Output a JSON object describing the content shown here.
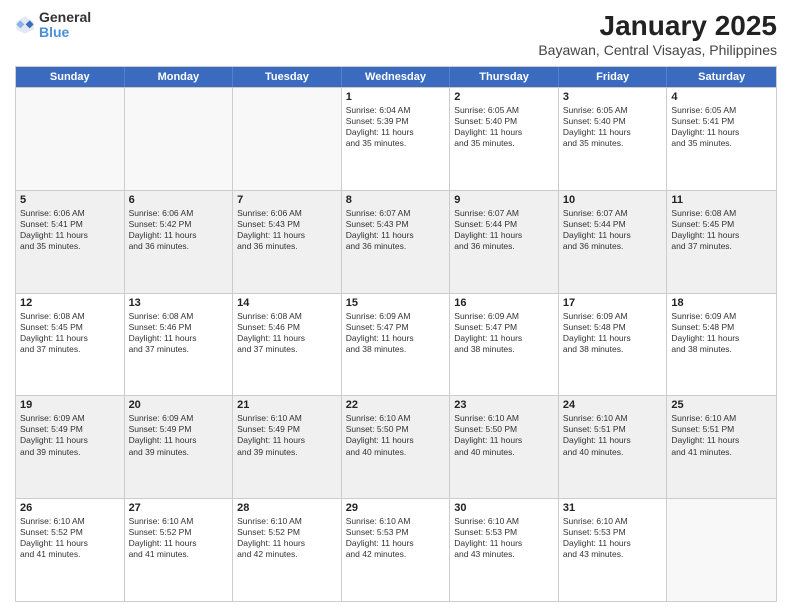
{
  "header": {
    "logo_general": "General",
    "logo_blue": "Blue",
    "title": "January 2025",
    "subtitle": "Bayawan, Central Visayas, Philippines"
  },
  "weekdays": [
    "Sunday",
    "Monday",
    "Tuesday",
    "Wednesday",
    "Thursday",
    "Friday",
    "Saturday"
  ],
  "weeks": [
    [
      {
        "day": "",
        "lines": [],
        "empty": true
      },
      {
        "day": "",
        "lines": [],
        "empty": true
      },
      {
        "day": "",
        "lines": [],
        "empty": true
      },
      {
        "day": "1",
        "lines": [
          "Sunrise: 6:04 AM",
          "Sunset: 5:39 PM",
          "Daylight: 11 hours",
          "and 35 minutes."
        ]
      },
      {
        "day": "2",
        "lines": [
          "Sunrise: 6:05 AM",
          "Sunset: 5:40 PM",
          "Daylight: 11 hours",
          "and 35 minutes."
        ]
      },
      {
        "day": "3",
        "lines": [
          "Sunrise: 6:05 AM",
          "Sunset: 5:40 PM",
          "Daylight: 11 hours",
          "and 35 minutes."
        ]
      },
      {
        "day": "4",
        "lines": [
          "Sunrise: 6:05 AM",
          "Sunset: 5:41 PM",
          "Daylight: 11 hours",
          "and 35 minutes."
        ]
      }
    ],
    [
      {
        "day": "5",
        "lines": [
          "Sunrise: 6:06 AM",
          "Sunset: 5:41 PM",
          "Daylight: 11 hours",
          "and 35 minutes."
        ]
      },
      {
        "day": "6",
        "lines": [
          "Sunrise: 6:06 AM",
          "Sunset: 5:42 PM",
          "Daylight: 11 hours",
          "and 36 minutes."
        ]
      },
      {
        "day": "7",
        "lines": [
          "Sunrise: 6:06 AM",
          "Sunset: 5:43 PM",
          "Daylight: 11 hours",
          "and 36 minutes."
        ]
      },
      {
        "day": "8",
        "lines": [
          "Sunrise: 6:07 AM",
          "Sunset: 5:43 PM",
          "Daylight: 11 hours",
          "and 36 minutes."
        ]
      },
      {
        "day": "9",
        "lines": [
          "Sunrise: 6:07 AM",
          "Sunset: 5:44 PM",
          "Daylight: 11 hours",
          "and 36 minutes."
        ]
      },
      {
        "day": "10",
        "lines": [
          "Sunrise: 6:07 AM",
          "Sunset: 5:44 PM",
          "Daylight: 11 hours",
          "and 36 minutes."
        ]
      },
      {
        "day": "11",
        "lines": [
          "Sunrise: 6:08 AM",
          "Sunset: 5:45 PM",
          "Daylight: 11 hours",
          "and 37 minutes."
        ]
      }
    ],
    [
      {
        "day": "12",
        "lines": [
          "Sunrise: 6:08 AM",
          "Sunset: 5:45 PM",
          "Daylight: 11 hours",
          "and 37 minutes."
        ]
      },
      {
        "day": "13",
        "lines": [
          "Sunrise: 6:08 AM",
          "Sunset: 5:46 PM",
          "Daylight: 11 hours",
          "and 37 minutes."
        ]
      },
      {
        "day": "14",
        "lines": [
          "Sunrise: 6:08 AM",
          "Sunset: 5:46 PM",
          "Daylight: 11 hours",
          "and 37 minutes."
        ]
      },
      {
        "day": "15",
        "lines": [
          "Sunrise: 6:09 AM",
          "Sunset: 5:47 PM",
          "Daylight: 11 hours",
          "and 38 minutes."
        ]
      },
      {
        "day": "16",
        "lines": [
          "Sunrise: 6:09 AM",
          "Sunset: 5:47 PM",
          "Daylight: 11 hours",
          "and 38 minutes."
        ]
      },
      {
        "day": "17",
        "lines": [
          "Sunrise: 6:09 AM",
          "Sunset: 5:48 PM",
          "Daylight: 11 hours",
          "and 38 minutes."
        ]
      },
      {
        "day": "18",
        "lines": [
          "Sunrise: 6:09 AM",
          "Sunset: 5:48 PM",
          "Daylight: 11 hours",
          "and 38 minutes."
        ]
      }
    ],
    [
      {
        "day": "19",
        "lines": [
          "Sunrise: 6:09 AM",
          "Sunset: 5:49 PM",
          "Daylight: 11 hours",
          "and 39 minutes."
        ]
      },
      {
        "day": "20",
        "lines": [
          "Sunrise: 6:09 AM",
          "Sunset: 5:49 PM",
          "Daylight: 11 hours",
          "and 39 minutes."
        ]
      },
      {
        "day": "21",
        "lines": [
          "Sunrise: 6:10 AM",
          "Sunset: 5:49 PM",
          "Daylight: 11 hours",
          "and 39 minutes."
        ]
      },
      {
        "day": "22",
        "lines": [
          "Sunrise: 6:10 AM",
          "Sunset: 5:50 PM",
          "Daylight: 11 hours",
          "and 40 minutes."
        ]
      },
      {
        "day": "23",
        "lines": [
          "Sunrise: 6:10 AM",
          "Sunset: 5:50 PM",
          "Daylight: 11 hours",
          "and 40 minutes."
        ]
      },
      {
        "day": "24",
        "lines": [
          "Sunrise: 6:10 AM",
          "Sunset: 5:51 PM",
          "Daylight: 11 hours",
          "and 40 minutes."
        ]
      },
      {
        "day": "25",
        "lines": [
          "Sunrise: 6:10 AM",
          "Sunset: 5:51 PM",
          "Daylight: 11 hours",
          "and 41 minutes."
        ]
      }
    ],
    [
      {
        "day": "26",
        "lines": [
          "Sunrise: 6:10 AM",
          "Sunset: 5:52 PM",
          "Daylight: 11 hours",
          "and 41 minutes."
        ]
      },
      {
        "day": "27",
        "lines": [
          "Sunrise: 6:10 AM",
          "Sunset: 5:52 PM",
          "Daylight: 11 hours",
          "and 41 minutes."
        ]
      },
      {
        "day": "28",
        "lines": [
          "Sunrise: 6:10 AM",
          "Sunset: 5:52 PM",
          "Daylight: 11 hours",
          "and 42 minutes."
        ]
      },
      {
        "day": "29",
        "lines": [
          "Sunrise: 6:10 AM",
          "Sunset: 5:53 PM",
          "Daylight: 11 hours",
          "and 42 minutes."
        ]
      },
      {
        "day": "30",
        "lines": [
          "Sunrise: 6:10 AM",
          "Sunset: 5:53 PM",
          "Daylight: 11 hours",
          "and 43 minutes."
        ]
      },
      {
        "day": "31",
        "lines": [
          "Sunrise: 6:10 AM",
          "Sunset: 5:53 PM",
          "Daylight: 11 hours",
          "and 43 minutes."
        ]
      },
      {
        "day": "",
        "lines": [],
        "empty": true
      }
    ]
  ]
}
